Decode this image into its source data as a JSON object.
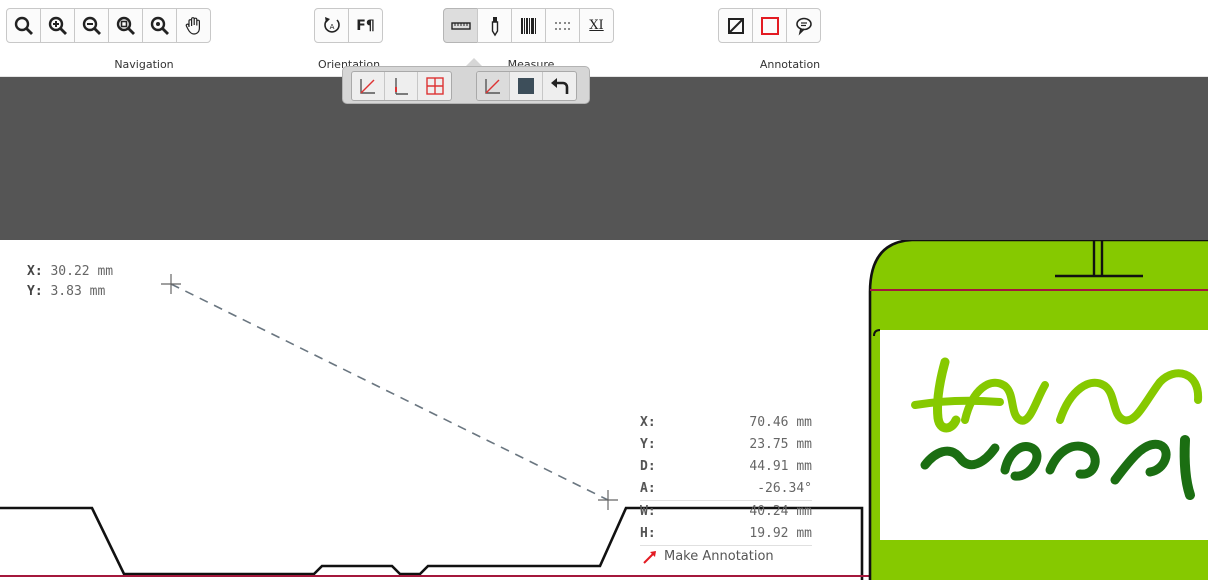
{
  "toolbar": {
    "groups": {
      "navigation": {
        "label": "Navigation",
        "icons": [
          "zoom-icon",
          "zoom-in-icon",
          "zoom-out-icon",
          "zoom-fit-icon",
          "zoom-selection-icon",
          "pan-hand-icon"
        ]
      },
      "orientation": {
        "label": "Orientation",
        "icons": [
          "rotate-icon",
          "flip-text-icon"
        ]
      },
      "measure": {
        "label": "Measure",
        "icons": [
          "ruler-icon",
          "eyedropper-icon",
          "barcode-icon",
          "dot-grid-icon",
          "xi-icon"
        ]
      },
      "annotation": {
        "label": "Annotation",
        "icons": [
          "diagonal-box-icon",
          "red-rectangle-icon",
          "speech-bubble-icon"
        ]
      }
    },
    "xi_label": "XI",
    "flip_label": "F¶"
  },
  "subbar": {
    "group1": [
      "angle-measure-icon",
      "corner-measure-icon",
      "grid-cross-icon"
    ],
    "group2": [
      "angle-measure-icon",
      "filled-square-icon",
      "undo-arrow-icon"
    ]
  },
  "cursor_coords": {
    "x_label": "X:",
    "x_value": "30.22 mm",
    "y_label": "Y:",
    "y_value": "3.83 mm"
  },
  "measurement": {
    "rows": [
      {
        "key": "X:",
        "value": "70.46 mm"
      },
      {
        "key": "Y:",
        "value": "23.75 mm"
      },
      {
        "key": "D:",
        "value": "44.91 mm"
      },
      {
        "key": "A:",
        "value": "-26.34°"
      },
      {
        "key": "W:",
        "value": "40.24 mm"
      },
      {
        "key": "H:",
        "value": "19.92 mm"
      }
    ],
    "annotate_label": "Make Annotation"
  },
  "colors": {
    "accent_green": "#86c900",
    "dark_green": "#1b6e12",
    "red_line": "#a4183c",
    "dark_band": "#555555"
  }
}
